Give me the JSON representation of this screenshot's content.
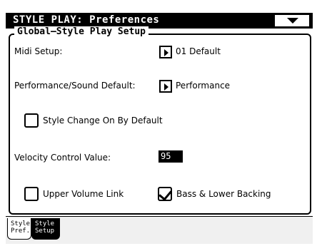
{
  "window": {
    "title": "STYLE PLAY: Preferences"
  },
  "group": {
    "title": "Global–Style Play Setup"
  },
  "midi": {
    "label": "Midi Setup:",
    "value": "01 Default"
  },
  "perf": {
    "label": "Performance/Sound Default:",
    "value": "Performance"
  },
  "style_change": {
    "label": "Style Change On By Default",
    "checked": false
  },
  "velocity": {
    "label": "Velocity Control Value:",
    "value": "95"
  },
  "upper_link": {
    "label": "Upper Volume Link",
    "checked": false
  },
  "bass_lower": {
    "label": "Bass & Lower Backing",
    "checked": true
  },
  "tabs": [
    {
      "line1": "Style",
      "line2": "Pref."
    },
    {
      "line1": "Style",
      "line2": "Setup"
    }
  ]
}
